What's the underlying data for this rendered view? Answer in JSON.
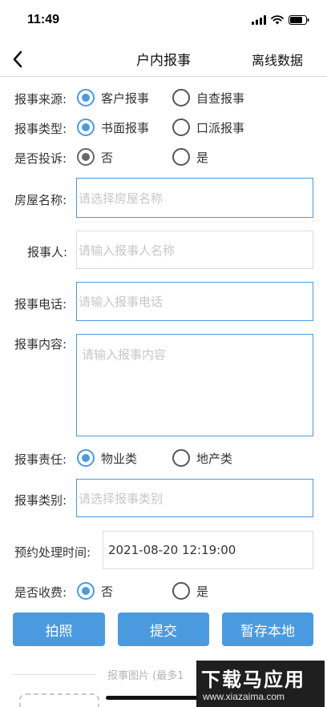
{
  "status_bar": {
    "time": "11:49"
  },
  "nav": {
    "title": "户内报事",
    "right_action": "离线数据"
  },
  "form": {
    "source": {
      "label": "报事来源:",
      "options": [
        "客户报事",
        "自查报事"
      ],
      "selected": "客户报事"
    },
    "type": {
      "label": "报事类型:",
      "options": [
        "书面报事",
        "口派报事"
      ],
      "selected": "书面报事"
    },
    "complaint": {
      "label": "是否投诉:",
      "options": [
        "否",
        "是"
      ],
      "selected": "否"
    },
    "house": {
      "label": "房屋名称:",
      "placeholder": "请选择房屋名称"
    },
    "reporter": {
      "label": "报事人:",
      "placeholder": "请输入报事人名称"
    },
    "phone": {
      "label": "报事电话:",
      "placeholder": "请输入报事电话"
    },
    "content": {
      "label": "报事内容:",
      "placeholder": "请输入报事内容"
    },
    "responsibility": {
      "label": "报事责任:",
      "options": [
        "物业类",
        "地产类"
      ],
      "selected": "物业类"
    },
    "category": {
      "label": "报事类别:",
      "placeholder": "请选择报事类别"
    },
    "appointment": {
      "label": "预约处理时间:",
      "value": "2021-08-20 12:19:00"
    },
    "charge": {
      "label": "是否收费:",
      "options": [
        "否",
        "是"
      ],
      "selected": "否"
    }
  },
  "buttons": {
    "photo": "拍照",
    "submit": "提交",
    "save_local": "暂存本地"
  },
  "photos": {
    "caption": "报事图片 (最多1"
  },
  "watermark": {
    "title": "下载马应用",
    "url": "www.xiazaima.com"
  },
  "colors": {
    "accent": "#4a9ae0",
    "border_idle": "#dcdcdc",
    "placeholder": "#c7c7c7"
  }
}
